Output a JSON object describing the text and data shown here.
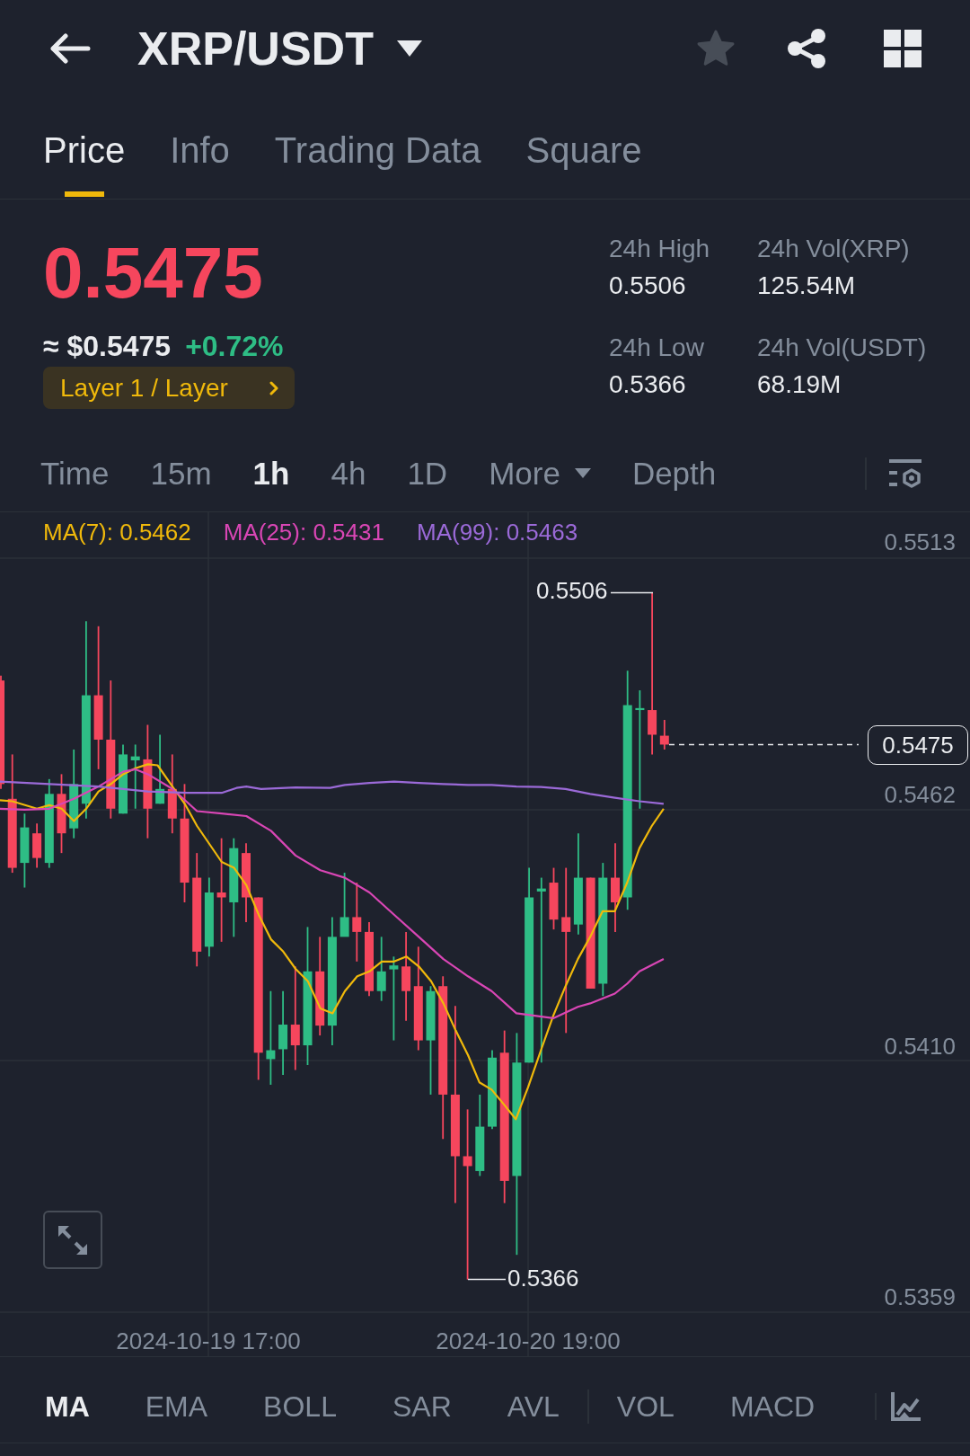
{
  "header": {
    "title": "XRP/USDT",
    "favorite": false
  },
  "tabs": [
    {
      "label": "Price",
      "selected": true
    },
    {
      "label": "Info",
      "selected": false
    },
    {
      "label": "Trading Data",
      "selected": false
    },
    {
      "label": "Square",
      "selected": false
    }
  ],
  "ticker": {
    "price": "0.5475",
    "price_down": true,
    "usd_price": "≈ $0.5475",
    "change": "+0.72%",
    "change_up": true,
    "tag": "Layer 1 / Layer"
  },
  "stats": [
    {
      "label": "24h High",
      "value": "0.5506"
    },
    {
      "label": "24h Vol(XRP)",
      "value": "125.54M"
    },
    {
      "label": "24h Low",
      "value": "0.5366"
    },
    {
      "label": "24h Vol(USDT)",
      "value": "68.19M"
    }
  ],
  "intervals": [
    {
      "label": "Time",
      "kind": "option",
      "selected": false
    },
    {
      "label": "15m",
      "kind": "option",
      "selected": false
    },
    {
      "label": "1h",
      "kind": "option",
      "selected": true
    },
    {
      "label": "4h",
      "kind": "option",
      "selected": false
    },
    {
      "label": "1D",
      "kind": "option",
      "selected": false
    },
    {
      "label": "More",
      "kind": "menu",
      "selected": false
    },
    {
      "label": "Depth",
      "kind": "option",
      "selected": false
    }
  ],
  "chart": {
    "moving_averages": [
      {
        "label": "MA(7): 0.5462",
        "color": "#f0b90b"
      },
      {
        "label": "MA(25): 0.5431",
        "color": "#d946b5"
      },
      {
        "label": "MA(99): 0.5463",
        "color": "#9b6ad8"
      }
    ],
    "price_axis": [
      "0.5513",
      "0.5462",
      "0.5410",
      "0.5359"
    ],
    "time_axis": [
      "2024-10-19 17:00",
      "2024-10-20 19:00"
    ],
    "high_label": "0.5506",
    "low_label": "0.5366",
    "last_price": "0.5475"
  },
  "indicators": {
    "main": [
      {
        "label": "MA",
        "selected": true
      },
      {
        "label": "EMA",
        "selected": false
      },
      {
        "label": "BOLL",
        "selected": false
      },
      {
        "label": "SAR",
        "selected": false
      },
      {
        "label": "AVL",
        "selected": false
      }
    ],
    "sub": [
      {
        "label": "VOL",
        "selected": false
      },
      {
        "label": "MACD",
        "selected": false
      }
    ]
  }
}
